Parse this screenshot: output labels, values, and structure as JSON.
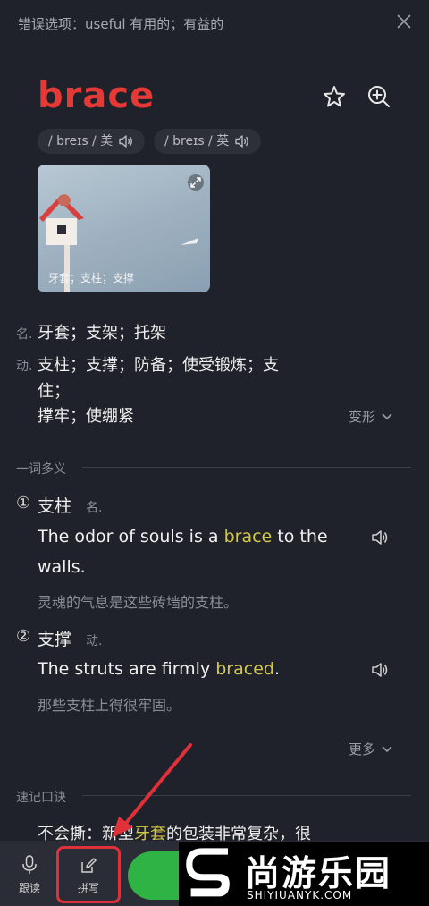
{
  "header": {
    "prefix": "错误选项：",
    "text": "useful 有用的；有益的"
  },
  "word": "brace",
  "phonetics": [
    {
      "text": "/ breɪs / 美"
    },
    {
      "text": "/ breɪs / 英"
    }
  ],
  "image_caption": "牙套；支柱；支撑",
  "definitions": [
    {
      "pos": "名.",
      "text": "牙套；支架；托架"
    },
    {
      "pos": "动.",
      "line1": "支柱；支撑；防备；使受锻炼；支",
      "line2": "住；",
      "line3": "撑牢；使绷紧"
    }
  ],
  "forms_label": "变形",
  "polysemy": {
    "title": "一词多义",
    "senses": [
      {
        "num": "①",
        "word": "支柱",
        "pos": "名.",
        "en_before": "The odor of souls is a ",
        "en_hl": "brace",
        "en_after": " to the",
        "en_line2": "walls.",
        "zh": "灵魂的气息是这些砖墙的支柱。"
      },
      {
        "num": "②",
        "word": "支撑",
        "pos": "动.",
        "en_before": "The struts are firmly ",
        "en_hl": "braced",
        "en_after": ".",
        "zh": "那些支柱上得很牢固。"
      }
    ],
    "more_label": "更多"
  },
  "mnemonic": {
    "title": "速记口诀",
    "prefix": "不会撕：新型",
    "hl": "牙套",
    "suffix": "的包装非常复杂，很"
  },
  "bottom": {
    "read_label": "跟读",
    "spell_label": "拼写"
  },
  "watermark": {
    "brand": "尚游乐园",
    "url": "SHIYIUANYK.COM"
  },
  "colors": {
    "accent_red": "#e53935",
    "highlight": "#d4c84a",
    "green": "#2fb344",
    "annotation": "#e0303a"
  }
}
